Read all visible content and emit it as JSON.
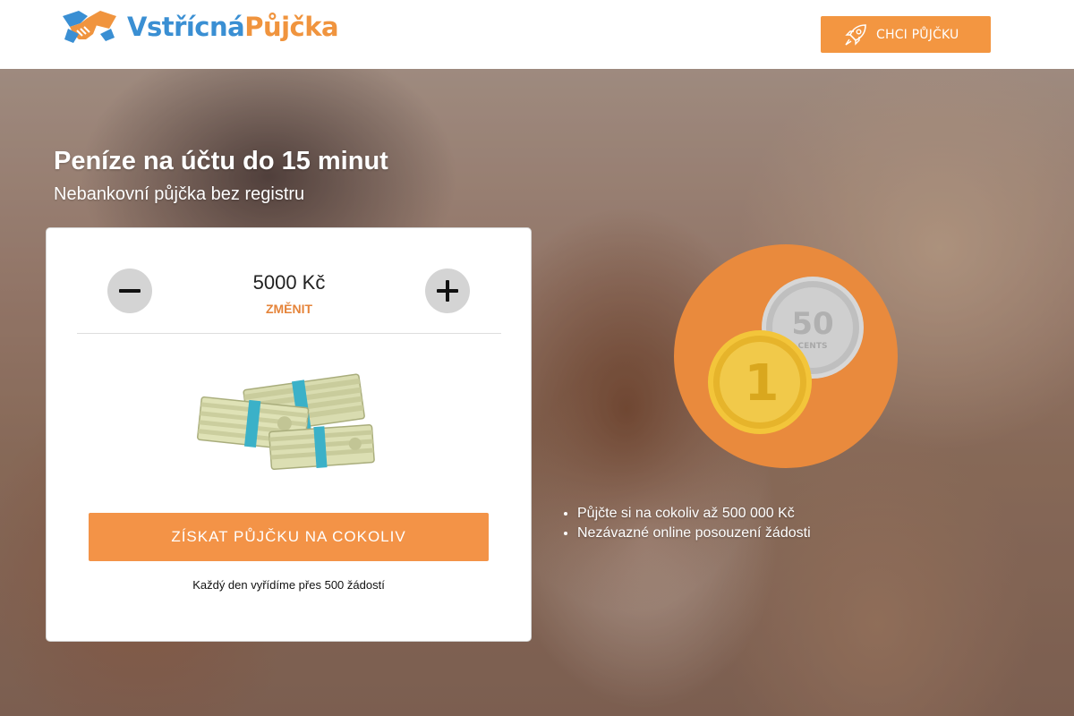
{
  "header": {
    "logo": {
      "text_part1": "Vstřícná",
      "text_part2": "Půjčka",
      "icon": "handshake-icon"
    },
    "cta_button": {
      "label": "CHCI PŮJČKU",
      "icon": "rocket-icon"
    }
  },
  "hero": {
    "title": "Peníze na účtu do 15 minut",
    "subtitle": "Nebankovní půjčka bez registru"
  },
  "calculator": {
    "amount": "5000 Kč",
    "change_label": "ZMĚNIT",
    "decrease_icon": "minus-icon",
    "increase_icon": "plus-icon",
    "image": "money-stack-icon",
    "submit_label": "ZÍSKAT PŮJČKU NA COKOLIV",
    "note": "Každý den vyřídíme přes 500 žádostí"
  },
  "coins": {
    "silver_coin_value": "50",
    "silver_coin_text": "CENTS",
    "gold_coin_value": "1"
  },
  "features": [
    "Půjčte si na cokoliv až 500 000 Kč",
    "Nezávazné online posouzení žádosti"
  ],
  "colors": {
    "accent": "#f39347",
    "logo_blue": "#3a8fd3",
    "logo_orange": "#f0943e",
    "link_orange": "#e5843a",
    "coin_circle": "#e98a3d"
  }
}
